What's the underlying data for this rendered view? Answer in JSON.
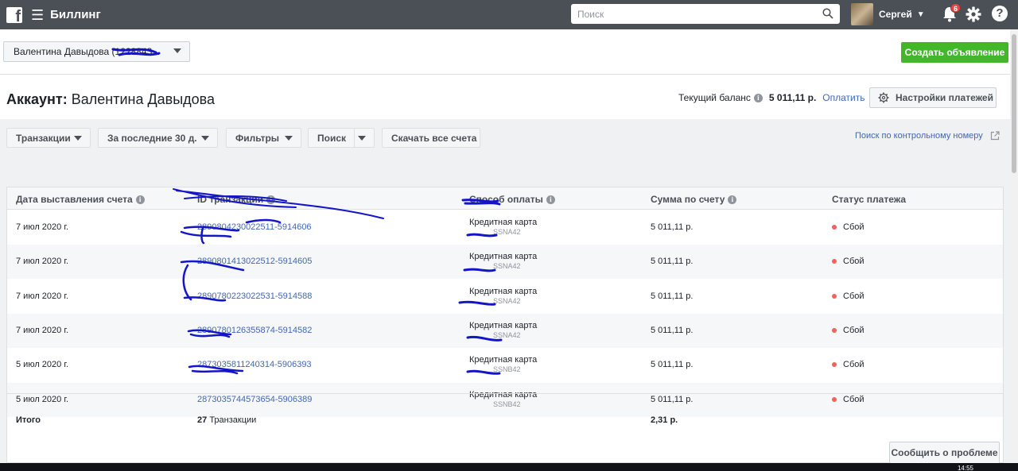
{
  "topbar": {
    "app_title": "Биллинг",
    "search_placeholder": "Поиск",
    "user_name": "Сергей",
    "notifications_count": "6"
  },
  "header": {
    "account_selector_label": "Валентина Давыдова (1228843...",
    "create_ad_label": "Создать объявление",
    "account_prefix": "Аккаунт:",
    "account_name": "Валентина Давыдова",
    "balance_label": "Текущий баланс",
    "balance_value": "5 011,11 р.",
    "pay_link": "Оплатить",
    "payment_settings_label": "Настройки платежей"
  },
  "toolbar": {
    "transactions_label": "Транзакции",
    "period_label": "За последние 30 д.",
    "filters_label": "Фильтры",
    "search_label": "Поиск",
    "download_label": "Скачать все счета",
    "reference_lookup_label": "Поиск по контрольному номеру"
  },
  "table": {
    "columns": [
      "Дата выставления счета",
      "ID транзакции",
      "Способ оплаты",
      "Сумма по счету",
      "Статус платежа"
    ],
    "rows": [
      {
        "date": "7 июл 2020 г.",
        "id": "2890804230022511-5914606",
        "method": "Кредитная карта",
        "method_sub": "SSNA42",
        "amount": "5 011,11 р.",
        "status": "Сбой"
      },
      {
        "date": "7 июл 2020 г.",
        "id": "2890801413022512-5914605",
        "method": "Кредитная карта",
        "method_sub": "SSNA42",
        "amount": "5 011,11 р.",
        "status": "Сбой"
      },
      {
        "date": "7 июл 2020 г.",
        "id": "2890780223022531-5914588",
        "method": "Кредитная карта",
        "method_sub": "SSNA42",
        "amount": "5 011,11 р.",
        "status": "Сбой"
      },
      {
        "date": "7 июл 2020 г.",
        "id": "2890780126355874-5914582",
        "method": "Кредитная карта",
        "method_sub": "SSNA42",
        "amount": "5 011,11 р.",
        "status": "Сбой"
      },
      {
        "date": "5 июл 2020 г.",
        "id": "2873035811240314-5906393",
        "method": "Кредитная карта",
        "method_sub": "SSNB42",
        "amount": "5 011,11 р.",
        "status": "Сбой"
      },
      {
        "date": "5 июл 2020 г.",
        "id": "2873035744573654-5906389",
        "method": "Кредитная карта",
        "method_sub": "SSNB42",
        "amount": "5 011,11 р.",
        "status": "Сбой"
      }
    ],
    "total_label": "Итого",
    "total_count": "27",
    "total_count_suffix": "Транзакции",
    "total_amount": "2,31 р."
  },
  "footer": {
    "report_problem_label": "Сообщить о проблеме",
    "clock": "14:55"
  },
  "colors": {
    "topbar": "#4b4f56",
    "accent_green": "#42b72a",
    "link_blue": "#4267b2",
    "fail_red": "#f0625c",
    "scribble": "#1515c8"
  }
}
